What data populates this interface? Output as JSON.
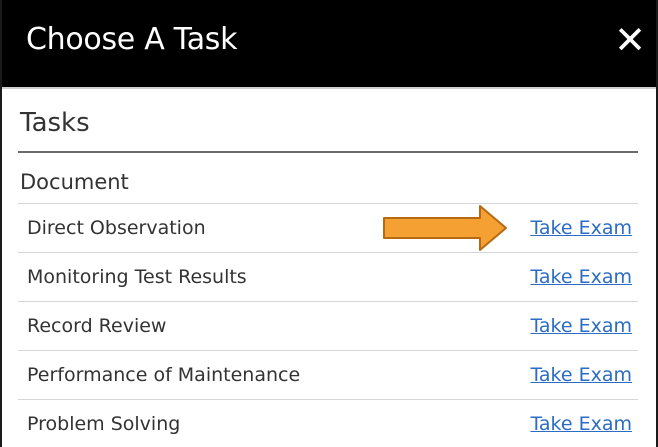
{
  "dialog": {
    "title": "Choose A Task",
    "close_label": "✕"
  },
  "tasks": {
    "heading": "Tasks",
    "section": "Document",
    "rows": [
      {
        "label": "Direct Observation",
        "link": "Take Exam"
      },
      {
        "label": "Monitoring Test Results",
        "link": "Take Exam"
      },
      {
        "label": "Record Review",
        "link": "Take Exam"
      },
      {
        "label": "Performance of Maintenance",
        "link": "Take Exam"
      },
      {
        "label": "Problem Solving",
        "link": "Take Exam"
      }
    ]
  },
  "colors": {
    "title_bar": "#000000",
    "link": "#2b6cc4",
    "arrow": "#f4a033"
  }
}
